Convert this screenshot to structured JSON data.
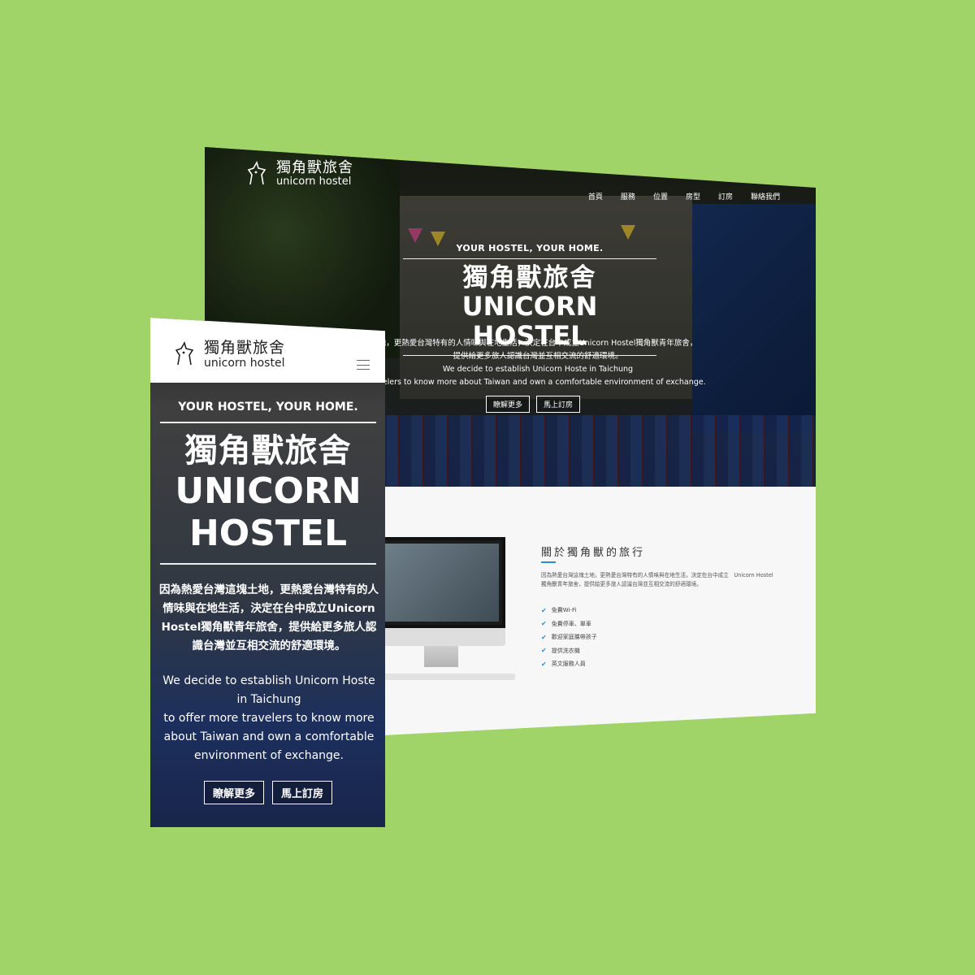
{
  "brand": {
    "name_cn": "獨角獸旅舍",
    "name_en": "unicorn hostel"
  },
  "desktop": {
    "nav": [
      "首頁",
      "服務",
      "位置",
      "房型",
      "訂房",
      "聯絡我們"
    ],
    "hero": {
      "tagline": "YOUR HOSTEL, YOUR HOME.",
      "title_cn": "獨角獸旅舍",
      "title_en": "UNICORN HOSTEL",
      "desc_line1": "地，更熱愛台灣特有的人情味與在地生活，決定在台中成立Unicorn Hostel獨角獸青年旅舍，",
      "desc_line2": "提供給更多旅人認識台灣並互相交流的舒適環境。",
      "desc_line3": "We decide to establish Unicorn Hoste in Taichung",
      "desc_line4": "ravelers to know more about Taiwan and own a comfortable environment of exchange.",
      "btn_more": "瞭解更多",
      "btn_book": "馬上訂房"
    },
    "about": {
      "title": "關於獨角獸的旅行",
      "text": "因為熱愛台灣這塊土地，更熱愛台灣特有的人情味與在地生活，決定在台中成立　Unicorn Hostel獨角獸青年旅舍，提供給更多旅人認識台灣並互相交流的舒適環境。",
      "features": [
        "免費Wi-Fi",
        "免費停車、單車",
        "歡迎家庭攜帶孩子",
        "提供洗衣機",
        "英文服務人員"
      ]
    }
  },
  "mobile": {
    "tagline": "YOUR HOSTEL, YOUR HOME.",
    "title_cn": "獨角獸旅舍",
    "title_en_1": "UNICORN",
    "title_en_2": "HOSTEL",
    "desc_cn": "因為熱愛台灣這塊土地，更熱愛台灣特有的人情味與在地生活，決定在台中成立Unicorn Hostel獨角獸青年旅舍，提供給更多旅人認識台灣並互相交流的舒適環境。",
    "desc_en_1": "We decide to establish Unicorn Hoste in Taichung",
    "desc_en_2": "to offer more travelers to know more about Taiwan and own a comfortable environment of exchange.",
    "btn_more": "瞭解更多",
    "btn_book": "馬上訂房"
  },
  "colors": {
    "background": "#a0d468",
    "accent": "#2a8bd6"
  }
}
